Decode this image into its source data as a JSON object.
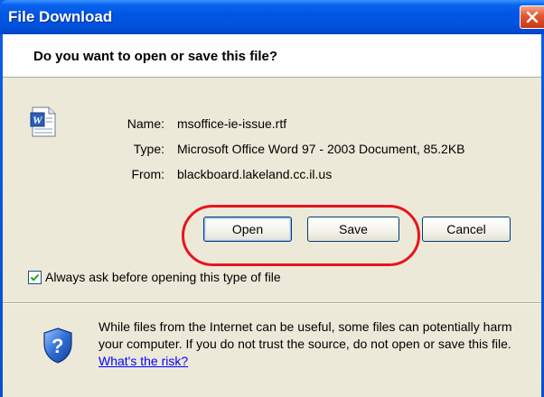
{
  "window": {
    "title": "File Download"
  },
  "dialog": {
    "question": "Do you want to open or save this file?",
    "fields": [
      {
        "label": "Name:",
        "value": "msoffice-ie-issue.rtf"
      },
      {
        "label": "Type:",
        "value": "Microsoft Office Word 97 - 2003 Document, 85.2KB"
      },
      {
        "label": "From:",
        "value": "blackboard.lakeland.cc.il.us"
      }
    ],
    "buttons": {
      "open": "Open",
      "save": "Save",
      "cancel": "Cancel"
    },
    "checkbox": {
      "label": "Always ask before opening this type of file",
      "checked": true
    },
    "warning": {
      "text": "While files from the Internet can be useful, some files can potentially harm your computer. If you do not trust the source, do not open or save this file.",
      "link": "What's the risk?"
    }
  },
  "icons": {
    "file": "word-document-icon",
    "security": "shield-question-icon",
    "close": "close-icon"
  },
  "colors": {
    "titlebar": "#0054e3",
    "highlight": "#e8141e",
    "link": "#0000ff",
    "dialog_bg": "#ece9d8"
  }
}
